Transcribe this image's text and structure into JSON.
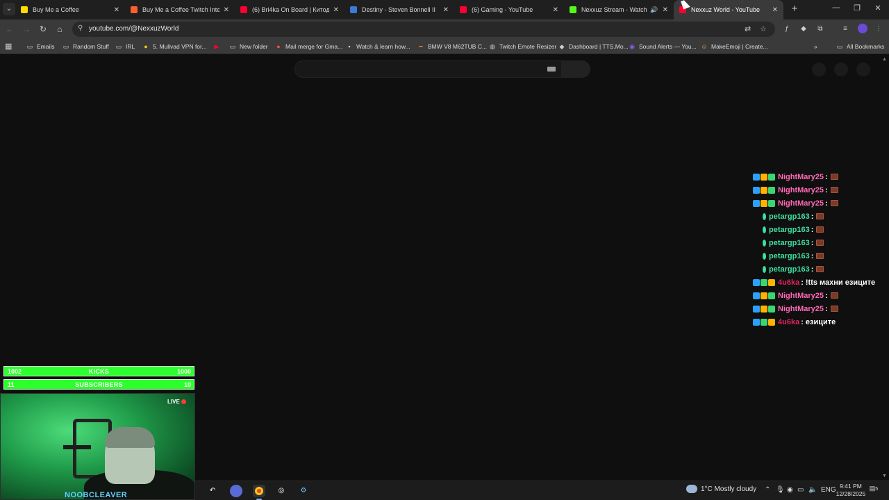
{
  "browser": {
    "tabs": [
      {
        "title": "Buy Me a Coffee",
        "favicon_color": "#ffdd00",
        "active": false
      },
      {
        "title": "Buy Me a Coffee Twitch Integra",
        "favicon_color": "#ff5f2e",
        "active": false
      },
      {
        "title": "(6) Bri4ka On Board | Китодар",
        "favicon_color": "#ff0033",
        "active": false
      },
      {
        "title": "Destiny - Steven Bonnell II",
        "favicon_color": "#3a7bd5",
        "active": false
      },
      {
        "title": "(6) Gaming - YouTube",
        "favicon_color": "#ff0033",
        "active": false
      },
      {
        "title": "Nexxuz Stream - Watch Live",
        "favicon_color": "#53fc18",
        "active": false,
        "audio": true
      },
      {
        "title": "Nexxuz World - YouTube",
        "favicon_color": "#ff0033",
        "active": true
      }
    ],
    "url": "youtube.com/@NexxuzWorld",
    "bookmarks": [
      {
        "label": "Emails",
        "icon": "folder-icon"
      },
      {
        "label": "Random Stuff",
        "icon": "folder-icon"
      },
      {
        "label": "IRL",
        "icon": "folder-icon"
      },
      {
        "label": "5. Mullvad VPN for...",
        "icon": "mullvad-icon"
      },
      {
        "label": "",
        "icon": "youtube-icon"
      },
      {
        "label": "New folder",
        "icon": "folder-icon"
      },
      {
        "label": "Mail merge for Gma...",
        "icon": "mail-merge-icon"
      },
      {
        "label": "Watch & learn how...",
        "icon": "watch-icon"
      },
      {
        "label": "BMW V8 M62TUB C...",
        "icon": "bmw-icon"
      },
      {
        "label": "Twitch Emote Resizer",
        "icon": "globe-icon"
      },
      {
        "label": "Dashboard | TTS.Mo...",
        "icon": "tts-icon"
      },
      {
        "label": "Sound Alerts — You...",
        "icon": "soundalerts-icon"
      },
      {
        "label": "MakeEmoji | Create...",
        "icon": "makeemoji-icon"
      }
    ],
    "all_bookmarks_label": "All Bookmarks"
  },
  "chat": [
    {
      "user": "NightMary25",
      "user_color": "#ff69b4",
      "message": "",
      "emote": true,
      "badges": [
        "#2aa0ff",
        "#ffb400",
        "#3bd671"
      ]
    },
    {
      "user": "NightMary25",
      "user_color": "#ff69b4",
      "message": "",
      "emote": true,
      "badges": [
        "#2aa0ff",
        "#ffb400",
        "#3bd671"
      ]
    },
    {
      "user": "NightMary25",
      "user_color": "#ff69b4",
      "message": "",
      "emote": true,
      "badges": [
        "#2aa0ff",
        "#ffb400",
        "#3bd671"
      ]
    },
    {
      "user": "petargp163",
      "user_color": "#3fe0a0",
      "message": "",
      "emote": true,
      "badges": [
        "#3fe0a0"
      ]
    },
    {
      "user": "petargp163",
      "user_color": "#3fe0a0",
      "message": "",
      "emote": true,
      "badges": [
        "#3fe0a0"
      ]
    },
    {
      "user": "petargp163",
      "user_color": "#3fe0a0",
      "message": "",
      "emote": true,
      "badges": [
        "#3fe0a0"
      ]
    },
    {
      "user": "petargp163",
      "user_color": "#3fe0a0",
      "message": "",
      "emote": true,
      "badges": [
        "#3fe0a0"
      ]
    },
    {
      "user": "petargp163",
      "user_color": "#3fe0a0",
      "message": "",
      "emote": true,
      "badges": [
        "#3fe0a0"
      ]
    },
    {
      "user": "4u6ka",
      "user_color": "#e0245e",
      "message": "!tts махни езиците",
      "emote": false,
      "badges": [
        "#2aa0ff",
        "#3bd671",
        "#ffb400"
      ]
    },
    {
      "user": "NightMary25",
      "user_color": "#ff69b4",
      "message": "",
      "emote": true,
      "badges": [
        "#2aa0ff",
        "#ffb400",
        "#3bd671"
      ]
    },
    {
      "user": "NightMary25",
      "user_color": "#ff69b4",
      "message": "",
      "emote": true,
      "badges": [
        "#2aa0ff",
        "#ffb400",
        "#3bd671"
      ]
    },
    {
      "user": "4u6ka",
      "user_color": "#e0245e",
      "message": "езиците",
      "emote": false,
      "badges": [
        "#2aa0ff",
        "#3bd671",
        "#ffb400"
      ]
    }
  ],
  "overlay": {
    "kicks": {
      "left": "1002",
      "label": "KICKS",
      "right": "1000"
    },
    "subscribers": {
      "left": "11",
      "label": "SUBSCRIBERS",
      "right": "10"
    },
    "live_label": "LIVE",
    "streamer_name": "NOOBCLEAVER"
  },
  "taskbar": {
    "weather": "1°C  Mostly cloudy",
    "language": "ENG",
    "time": "9:41 PM",
    "date": "12/28/2025",
    "notification_count": "5"
  },
  "colors": {
    "accent_green": "#2cff2c",
    "page_bg": "#0f0f0f"
  }
}
